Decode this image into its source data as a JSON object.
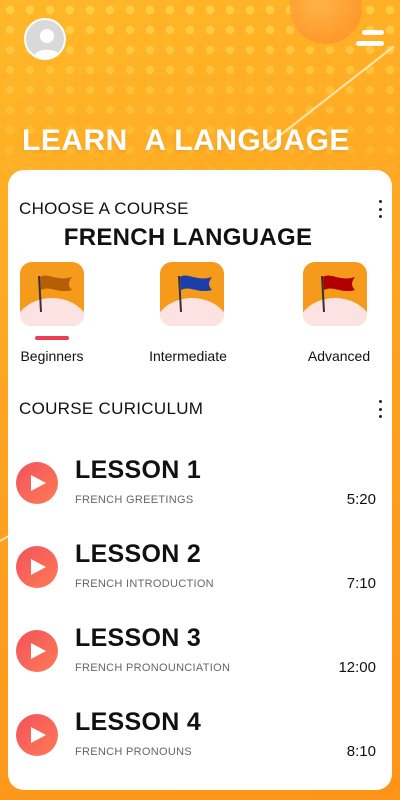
{
  "header": {
    "title": "LEARN  A LANGUAGE",
    "avatar_icon": "user-avatar-icon",
    "menu_icon": "menu-icon"
  },
  "course": {
    "section_title": "CHOOSE A COURSE",
    "course_name": "FRENCH LANGUAGE",
    "levels": [
      {
        "label": "Beginners",
        "flag_color": "#b45f06",
        "selected": true
      },
      {
        "label": "Intermediate",
        "flag_color": "#1a3faa",
        "selected": false
      },
      {
        "label": "Advanced",
        "flag_color": "#b00000",
        "selected": false
      }
    ]
  },
  "curriculum": {
    "section_title": "COURSE CURICULUM",
    "lessons": [
      {
        "title": "LESSON 1",
        "subtitle": "FRENCH GREETINGS",
        "duration": "5:20"
      },
      {
        "title": "LESSON 2",
        "subtitle": "FRENCH INTRODUCTION",
        "duration": "7:10"
      },
      {
        "title": "LESSON 3",
        "subtitle": "FRENCH PRONOUNCIATION",
        "duration": "12:00"
      },
      {
        "title": "LESSON 4",
        "subtitle": "FRENCH PRONOUNS",
        "duration": "8:10"
      }
    ]
  },
  "colors": {
    "accent": "#ec3d52",
    "background": "#ffa321",
    "level_tile": "#f59a1b"
  }
}
